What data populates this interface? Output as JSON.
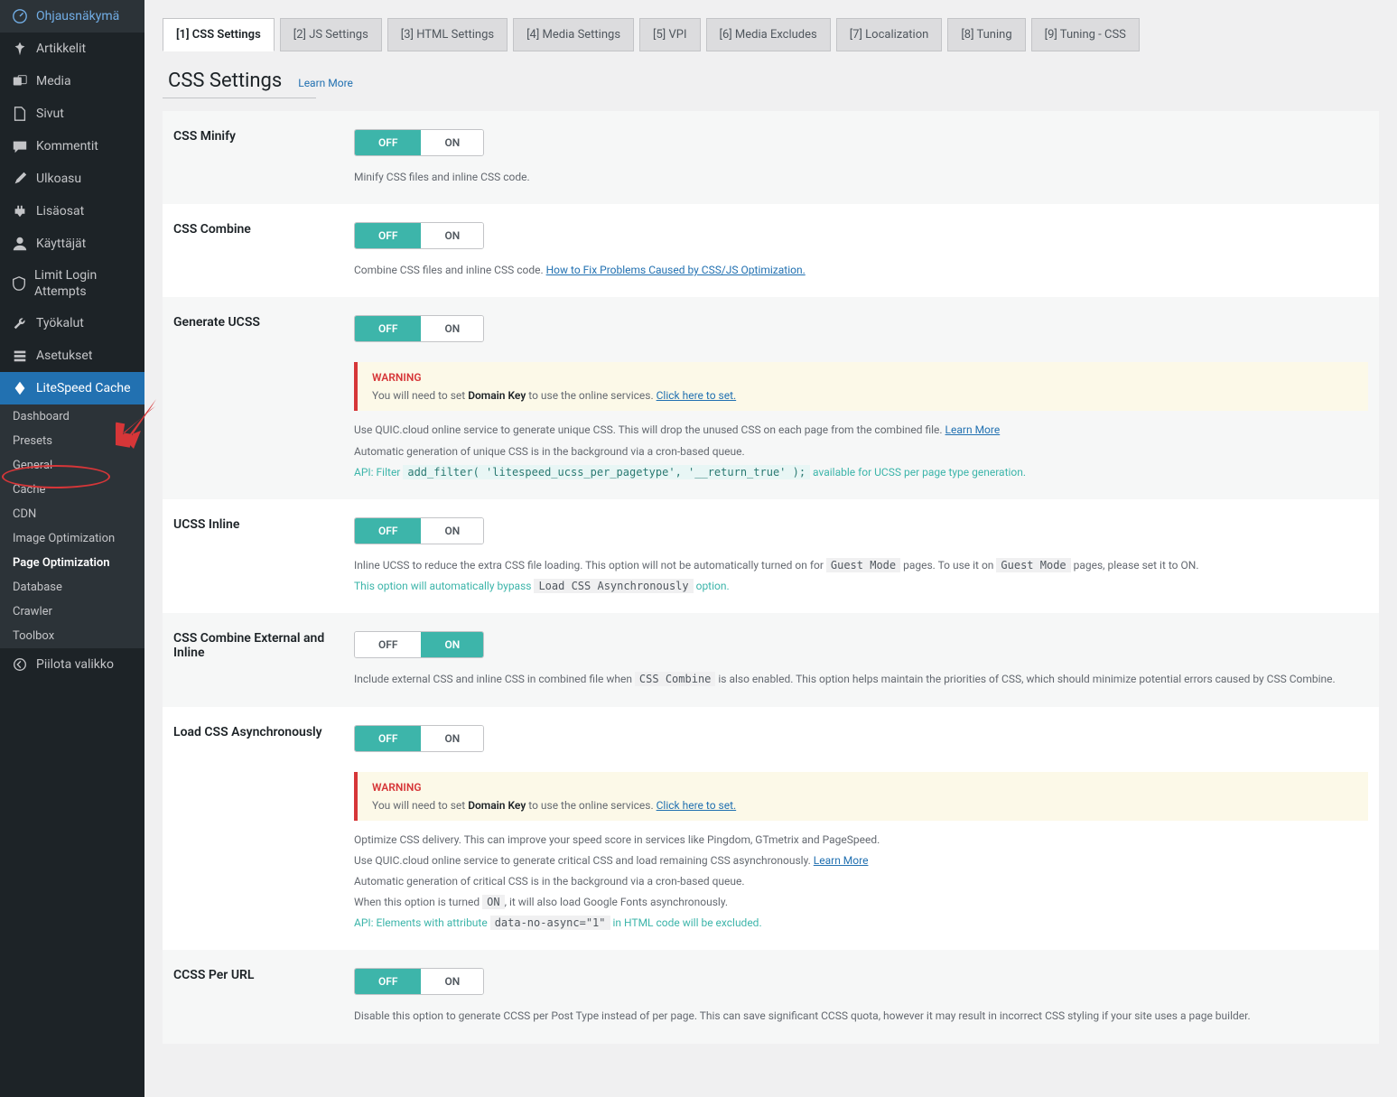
{
  "sidebar": {
    "items": [
      {
        "icon": "dashboard",
        "label": "Ohjausnäkymä"
      },
      {
        "icon": "pin",
        "label": "Artikkelit"
      },
      {
        "icon": "media",
        "label": "Media"
      },
      {
        "icon": "page",
        "label": "Sivut"
      },
      {
        "icon": "comment",
        "label": "Kommentit"
      },
      {
        "icon": "brush",
        "label": "Ulkoasu"
      },
      {
        "icon": "plugin",
        "label": "Lisäosat"
      },
      {
        "icon": "user",
        "label": "Käyttäjät"
      },
      {
        "icon": "shield",
        "label": "Limit Login Attempts"
      },
      {
        "icon": "tool",
        "label": "Työkalut"
      },
      {
        "icon": "settings",
        "label": "Asetukset"
      },
      {
        "icon": "litespeed",
        "label": "LiteSpeed Cache"
      }
    ],
    "submenu": [
      "Dashboard",
      "Presets",
      "General",
      "Cache",
      "CDN",
      "Image Optimization",
      "Page Optimization",
      "Database",
      "Crawler",
      "Toolbox"
    ],
    "collapse": "Piilota valikko"
  },
  "tabs": [
    "[1] CSS Settings",
    "[2] JS Settings",
    "[3] HTML Settings",
    "[4] Media Settings",
    "[5] VPI",
    "[6] Media Excludes",
    "[7] Localization",
    "[8] Tuning",
    "[9] Tuning - CSS"
  ],
  "section": {
    "title": "CSS Settings",
    "learn_more": "Learn More"
  },
  "rows": {
    "css_minify": {
      "label": "CSS Minify",
      "state": "OFF",
      "desc": "Minify CSS files and inline CSS code."
    },
    "css_combine": {
      "label": "CSS Combine",
      "state": "OFF",
      "desc_pre": "Combine CSS files and inline CSS code. ",
      "link": "How to Fix Problems Caused by CSS/JS Optimization."
    },
    "generate_ucss": {
      "label": "Generate UCSS",
      "state": "OFF",
      "warning_title": "WARNING",
      "warning_text_pre": "You will need to set ",
      "warning_bold": "Domain Key",
      "warning_text_mid": " to use the online services. ",
      "warning_link": "Click here to set.",
      "desc1_pre": "Use QUIC.cloud online service to generate unique CSS. This will drop the unused CSS on each page from the combined file. ",
      "desc1_link": "Learn More",
      "desc2": "Automatic generation of unique CSS is in the background via a cron-based queue.",
      "api_label": "API: ",
      "api_filter": "Filter ",
      "api_code": "add_filter( 'litespeed_ucss_per_pagetype', '__return_true' );",
      "api_suffix": " available for UCSS per page type generation."
    },
    "ucss_inline": {
      "label": "UCSS Inline",
      "state": "OFF",
      "desc_pre": "Inline UCSS to reduce the extra CSS file loading. This option will not be automatically turned on for ",
      "code1": "Guest Mode",
      "desc_mid": " pages. To use it on ",
      "code2": "Guest Mode",
      "desc_suf": " pages, please set it to ON.",
      "bypass_pre": "This option will automatically bypass ",
      "bypass_code": "Load CSS Asynchronously",
      "bypass_suf": " option."
    },
    "css_combine_ext": {
      "label": "CSS Combine External and Inline",
      "state": "ON",
      "desc_pre": "Include external CSS and inline CSS in combined file when ",
      "code": "CSS Combine",
      "desc_suf": " is also enabled. This option helps maintain the priorities of CSS, which should minimize potential errors caused by CSS Combine."
    },
    "load_async": {
      "label": "Load CSS Asynchronously",
      "state": "OFF",
      "warning_title": "WARNING",
      "warning_text_pre": "You will need to set ",
      "warning_bold": "Domain Key",
      "warning_text_mid": " to use the online services. ",
      "warning_link": "Click here to set.",
      "desc1": "Optimize CSS delivery. This can improve your speed score in services like Pingdom, GTmetrix and PageSpeed.",
      "desc2_pre": "Use QUIC.cloud online service to generate critical CSS and load remaining CSS asynchronously. ",
      "desc2_link": "Learn More",
      "desc3": "Automatic generation of critical CSS is in the background via a cron-based queue.",
      "desc4_pre": "When this option is turned ",
      "desc4_code": "ON",
      "desc4_suf": ", it will also load Google Fonts asynchronously.",
      "api_label": "API: ",
      "api_mid": "Elements with attribute ",
      "api_code": "data-no-async=\"1\"",
      "api_suf": " in HTML code will be excluded."
    },
    "ccss_per_url": {
      "label": "CCSS Per URL",
      "state": "OFF",
      "desc": "Disable this option to generate CCSS per Post Type instead of per page. This can save significant CCSS quota, however it may result in incorrect CSS styling if your site uses a page builder."
    }
  },
  "toggle_labels": {
    "off": "OFF",
    "on": "ON"
  }
}
